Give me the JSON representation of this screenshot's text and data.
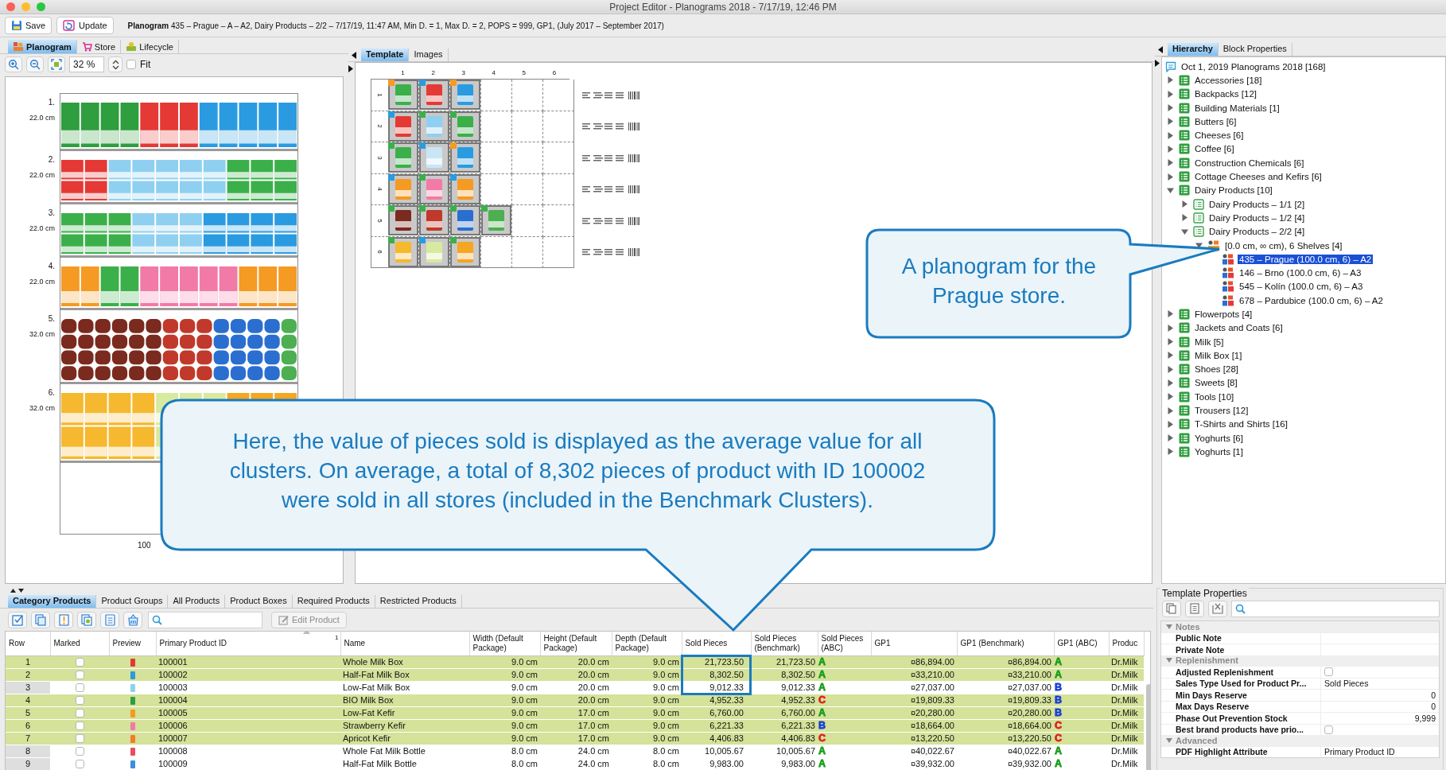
{
  "window": {
    "title": "Project Editor - Planograms 2018 - 7/17/19, 12:46 PM"
  },
  "toolbar": {
    "buttons": [
      {
        "label": "Save",
        "kind": "save"
      },
      {
        "label": "Update",
        "kind": "update"
      }
    ],
    "info": "**Planogram** 435 – Prague – A – A2, Dairy Products – 2/2 – 7/17/19, 11:47 AM, Min D. = 1, Max D. = 2, POPS = 999, GP1, (July 2017 – September 2017)"
  },
  "view_tabs": [
    {
      "label": "Planogram",
      "kind": "planogram",
      "selected": true
    },
    {
      "label": "Store",
      "kind": "store",
      "selected": false
    },
    {
      "label": "Lifecycle",
      "kind": "lifecycle",
      "selected": false
    }
  ],
  "zoom": {
    "value": "32 %",
    "fit": {
      "label": "Fit",
      "checked": false
    }
  },
  "planogram": {
    "shelves": [
      {
        "number": "1.",
        "height": "22.0 cm"
      },
      {
        "number": "2.",
        "height": "22.0 cm"
      },
      {
        "number": "3.",
        "height": "22.0 cm"
      },
      {
        "number": "4.",
        "height": "22.0 cm"
      },
      {
        "number": "5.",
        "height": "32.0 cm"
      },
      {
        "number": "6.",
        "height": "32.0 cm"
      }
    ],
    "width_label": "100"
  },
  "template_tabs": [
    {
      "label": "Template",
      "selected": true
    },
    {
      "label": "Images",
      "selected": false
    }
  ],
  "template": {
    "columns": [
      "1",
      "2",
      "3",
      "4",
      "5",
      "6"
    ],
    "rows": [
      "1",
      "2",
      "3",
      "4",
      "5",
      "6"
    ]
  },
  "hierarchy_tabs": [
    {
      "label": "Hierarchy",
      "selected": true
    },
    {
      "label": "Block Properties",
      "selected": false
    }
  ],
  "hierarchy": {
    "label": "Oct 1, 2019 Planograms 2018 [168]",
    "kind": "root",
    "selected": false,
    "children": [
      {
        "label": "Accessories [18]",
        "kind": "category",
        "expanded": false,
        "selected": false
      },
      {
        "label": "Backpacks [12]",
        "kind": "category",
        "expanded": false,
        "selected": false
      },
      {
        "label": "Building Materials [1]",
        "kind": "category",
        "expanded": false,
        "selected": false
      },
      {
        "label": "Butters [6]",
        "kind": "category",
        "expanded": false,
        "selected": false
      },
      {
        "label": "Cheeses [6]",
        "kind": "category",
        "expanded": false,
        "selected": false
      },
      {
        "label": "Coffee [6]",
        "kind": "category",
        "expanded": false,
        "selected": false
      },
      {
        "label": "Construction Chemicals [6]",
        "kind": "category",
        "expanded": false,
        "selected": false
      },
      {
        "label": "Cottage Cheeses and Kefirs [6]",
        "kind": "category",
        "expanded": false,
        "selected": false
      },
      {
        "label": "Dairy Products [10]",
        "kind": "category",
        "expanded": true,
        "selected": false,
        "children": [
          {
            "label": "Dairy Products – 1/1 [2]",
            "kind": "subcategory",
            "expanded": false,
            "selected": false
          },
          {
            "label": "Dairy Products – 1/2 [4]",
            "kind": "subcategory",
            "expanded": false,
            "selected": false
          },
          {
            "label": "Dairy Products – 2/2 [4]",
            "kind": "subcategory",
            "expanded": true,
            "selected": false,
            "children": [
              {
                "label": "[0.0 cm, ∞ cm), 6 Shelves [4]",
                "kind": "shelf-set",
                "expanded": true,
                "selected": false,
                "children": [
                  {
                    "label": "435 – Prague (100.0 cm, 6) – A2",
                    "kind": "planogram",
                    "selected": true
                  },
                  {
                    "label": "146 – Brno (100.0 cm, 6) – A3",
                    "kind": "planogram",
                    "selected": false
                  },
                  {
                    "label": "545 – Kolín (100.0 cm, 6) – A3",
                    "kind": "planogram",
                    "selected": false
                  },
                  {
                    "label": "678 – Pardubice  (100.0 cm, 6) – A2",
                    "kind": "planogram",
                    "selected": false
                  }
                ]
              }
            ]
          }
        ]
      },
      {
        "label": "Flowerpots [4]",
        "kind": "category",
        "expanded": false,
        "selected": false
      },
      {
        "label": "Jackets and Coats [6]",
        "kind": "category",
        "expanded": false,
        "selected": false
      },
      {
        "label": "Milk [5]",
        "kind": "category",
        "expanded": false,
        "selected": false
      },
      {
        "label": "Milk Box [1]",
        "kind": "category",
        "expanded": false,
        "selected": false
      },
      {
        "label": "Shoes [28]",
        "kind": "category",
        "expanded": false,
        "selected": false
      },
      {
        "label": "Sweets [8]",
        "kind": "category",
        "expanded": false,
        "selected": false
      },
      {
        "label": "Tools [10]",
        "kind": "category",
        "expanded": false,
        "selected": false
      },
      {
        "label": "Trousers [12]",
        "kind": "category",
        "expanded": false,
        "selected": false
      },
      {
        "label": "T-Shirts and Shirts [16]",
        "kind": "category",
        "expanded": false,
        "selected": false
      },
      {
        "label": "Yoghurts [6]",
        "kind": "category",
        "expanded": false,
        "selected": false
      },
      {
        "label": "Yoghurts [1]",
        "kind": "category",
        "expanded": false,
        "selected": false
      }
    ]
  },
  "product_tabs": [
    {
      "label": "Category Products",
      "selected": true
    },
    {
      "label": "Product Groups",
      "selected": false
    },
    {
      "label": "All Products",
      "selected": false
    },
    {
      "label": "Product Boxes",
      "selected": false
    },
    {
      "label": "Required Products",
      "selected": false
    },
    {
      "label": "Restricted Products",
      "selected": false
    }
  ],
  "edit_button": {
    "label": "Edit Product",
    "disabled": true
  },
  "table": {
    "columns": [
      "Row",
      "Marked",
      "Preview",
      "Primary Product ID",
      "Name",
      "Width (Default Package)",
      "Height (Default Package)",
      "Depth (Default Package)",
      "Sold Pieces",
      "Sold Pieces (Benchmark)",
      "Sold Pieces (ABC)",
      "GP1",
      "GP1 (Benchmark)",
      "GP1 (ABC)",
      "Produc"
    ],
    "sort_index": "1",
    "rows": [
      {
        "row": "1",
        "marked": false,
        "color": "#e53935",
        "id": "100001",
        "name": "Whole Milk Box",
        "width": "9.0 cm",
        "height": "20.0 cm",
        "depth": "9.0 cm",
        "sold": "21,723.50",
        "sold_bench": "21,723.50",
        "sold_abc": {
          "grade": "A",
          "color": "#1e9e1e"
        },
        "gp1": "¤86,894.00",
        "gp1_bench": "¤86,894.00",
        "gp1_abc": {
          "grade": "A",
          "color": "#1e9e1e"
        },
        "producer": "Dr.Milk",
        "highlighted": true
      },
      {
        "row": "2",
        "marked": false,
        "color": "#2a9be0",
        "id": "100002",
        "name": "Half-Fat Milk Box",
        "width": "9.0 cm",
        "height": "20.0 cm",
        "depth": "9.0 cm",
        "sold": "8,302.50",
        "sold_bench": "8,302.50",
        "sold_abc": {
          "grade": "A",
          "color": "#1e9e1e"
        },
        "gp1": "¤33,210.00",
        "gp1_bench": "¤33,210.00",
        "gp1_abc": {
          "grade": "A",
          "color": "#1e9e1e"
        },
        "producer": "Dr.Milk",
        "highlighted": true
      },
      {
        "row": "3",
        "marked": false,
        "color": "#8fd0f0",
        "id": "100003",
        "name": "Low-Fat Milk Box",
        "width": "9.0 cm",
        "height": "20.0 cm",
        "depth": "9.0 cm",
        "sold": "9,012.33",
        "sold_bench": "9,012.33",
        "sold_abc": {
          "grade": "A",
          "color": "#1e9e1e"
        },
        "gp1": "¤27,037.00",
        "gp1_bench": "¤27,037.00",
        "gp1_abc": {
          "grade": "B",
          "color": "#1a3fd6"
        },
        "producer": "Dr.Milk",
        "highlighted": false
      },
      {
        "row": "4",
        "marked": false,
        "color": "#2e9e3e",
        "id": "100004",
        "name": "BIO Milk Box",
        "width": "9.0 cm",
        "height": "20.0 cm",
        "depth": "9.0 cm",
        "sold": "4,952.33",
        "sold_bench": "4,952.33",
        "sold_abc": {
          "grade": "C",
          "color": "#e02020"
        },
        "gp1": "¤19,809.33",
        "gp1_bench": "¤19,809.33",
        "gp1_abc": {
          "grade": "B",
          "color": "#1a3fd6"
        },
        "producer": "Dr.Milk",
        "highlighted": true
      },
      {
        "row": "5",
        "marked": false,
        "color": "#f59a23",
        "id": "100005",
        "name": "Low-Fat Kefir",
        "width": "9.0 cm",
        "height": "17.0 cm",
        "depth": "9.0 cm",
        "sold": "6,760.00",
        "sold_bench": "6,760.00",
        "sold_abc": {
          "grade": "A",
          "color": "#1e9e1e"
        },
        "gp1": "¤20,280.00",
        "gp1_bench": "¤20,280.00",
        "gp1_abc": {
          "grade": "B",
          "color": "#1a3fd6"
        },
        "producer": "Dr.Milk",
        "highlighted": true
      },
      {
        "row": "6",
        "marked": false,
        "color": "#f27aa6",
        "id": "100006",
        "name": "Strawberry Kefir",
        "width": "9.0 cm",
        "height": "17.0 cm",
        "depth": "9.0 cm",
        "sold": "6,221.33",
        "sold_bench": "6,221.33",
        "sold_abc": {
          "grade": "B",
          "color": "#1a3fd6"
        },
        "gp1": "¤18,664.00",
        "gp1_bench": "¤18,664.00",
        "gp1_abc": {
          "grade": "C",
          "color": "#e02020"
        },
        "producer": "Dr.Milk",
        "highlighted": true
      },
      {
        "row": "7",
        "marked": false,
        "color": "#f57c23",
        "id": "100007",
        "name": "Apricot Kefir",
        "width": "9.0 cm",
        "height": "17.0 cm",
        "depth": "9.0 cm",
        "sold": "4,406.83",
        "sold_bench": "4,406.83",
        "sold_abc": {
          "grade": "C",
          "color": "#e02020"
        },
        "gp1": "¤13,220.50",
        "gp1_bench": "¤13,220.50",
        "gp1_abc": {
          "grade": "C",
          "color": "#e02020"
        },
        "producer": "Dr.Milk",
        "highlighted": true
      },
      {
        "row": "8",
        "marked": false,
        "color": "#e8505b",
        "id": "100008",
        "name": "Whole Fat Milk Bottle",
        "width": "8.0 cm",
        "height": "24.0 cm",
        "depth": "8.0 cm",
        "sold": "10,005.67",
        "sold_bench": "10,005.67",
        "sold_abc": {
          "grade": "A",
          "color": "#1e9e1e"
        },
        "gp1": "¤40,022.67",
        "gp1_bench": "¤40,022.67",
        "gp1_abc": {
          "grade": "A",
          "color": "#1e9e1e"
        },
        "producer": "Dr.Milk",
        "highlighted": false
      },
      {
        "row": "9",
        "marked": false,
        "color": "#3a8fe0",
        "id": "100009",
        "name": "Half-Fat Milk Bottle",
        "width": "8.0 cm",
        "height": "24.0 cm",
        "depth": "8.0 cm",
        "sold": "9,983.00",
        "sold_bench": "9,983.00",
        "sold_abc": {
          "grade": "A",
          "color": "#1e9e1e"
        },
        "gp1": "¤39,932.00",
        "gp1_bench": "¤39,932.00",
        "gp1_abc": {
          "grade": "A",
          "color": "#1e9e1e"
        },
        "producer": "Dr.Milk",
        "highlighted": false
      }
    ]
  },
  "properties": {
    "title": "Template Properties",
    "sections": [
      {
        "label": "Notes",
        "expanded": true,
        "rows": [
          {
            "label": "Public Note",
            "kind": "text"
          },
          {
            "label": "Private Note",
            "kind": "text"
          }
        ]
      },
      {
        "label": "Replenishment",
        "expanded": true,
        "rows": [
          {
            "label": "Adjusted Replenishment",
            "kind": "checkbox",
            "checked": false
          },
          {
            "label": "Sales Type Used for Product Pr...",
            "kind": "text",
            "value": "Sold Pieces"
          },
          {
            "label": "Min Days Reserve",
            "kind": "number",
            "value": "0"
          },
          {
            "label": "Max Days Reserve",
            "kind": "number",
            "value": "0"
          },
          {
            "label": "Phase Out Prevention Stock",
            "kind": "number",
            "value": "9,999"
          },
          {
            "label": "Best brand products have prio...",
            "kind": "checkbox",
            "checked": false
          }
        ]
      },
      {
        "label": "Advanced",
        "expanded": true,
        "rows": [
          {
            "label": "PDF Highlight Attribute",
            "kind": "text",
            "value": "Primary Product ID"
          }
        ]
      }
    ]
  },
  "callouts": [
    {
      "text": "A planogram for the Prague store."
    },
    {
      "text": "Here, the value of pieces sold is displayed as the average value for all clusters. On average, a total of 8,302 pieces of product with ID 100002 were sold in all stores (included in the Benchmark Clusters)."
    }
  ]
}
